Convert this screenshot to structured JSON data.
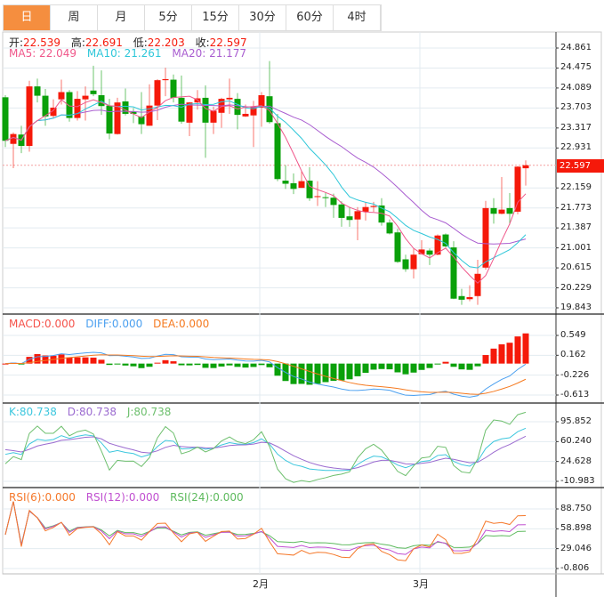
{
  "tabs": [
    "日",
    "周",
    "月",
    "5分",
    "15分",
    "30分",
    "60分",
    "4时"
  ],
  "active_tab": 0,
  "ohlc_header": {
    "open_label": "开:",
    "open": "22.539",
    "high_label": "高:",
    "high": "22.691",
    "low_label": "低:",
    "low": "22.203",
    "close_label": "收:",
    "close": "22.597"
  },
  "ma_header": {
    "ma5": "MA5: 22.049",
    "ma10": "MA10: 21.261",
    "ma20": "MA20: 21.177"
  },
  "macd_header": {
    "macd": "MACD:0.000",
    "diff": "DIFF:0.000",
    "dea": "DEA:0.000"
  },
  "kdj_header": {
    "k": "K:80.738",
    "d": "D:80.738",
    "j": "J:80.738"
  },
  "rsi_header": {
    "rsi6": "RSI(6):0.000",
    "rsi12": "RSI(12):0.000",
    "rsi24": "RSI(24):0.000"
  },
  "colors": {
    "up": "#F5190A",
    "down": "#0AA00A",
    "ma5": "#F0578A",
    "ma10": "#2EC7D9",
    "ma20": "#A95DD0",
    "diff": "#4BA0F0",
    "dea": "#F57A20",
    "k": "#3DC7DE",
    "d": "#9B6BD0",
    "j": "#6DBF6D",
    "rsi6": "#F5782A",
    "rsi12": "#C04FD0",
    "rsi24": "#5DBA5D",
    "tab_active": "#F58E3F"
  },
  "current_price": "22.597",
  "chart_data": {
    "type": "candlestick",
    "x_labels": [
      {
        "index": 32,
        "label": "2月"
      },
      {
        "index": 52,
        "label": "3月"
      }
    ],
    "price_ticks": [
      "24.861",
      "24.475",
      "24.089",
      "23.703",
      "23.317",
      "22.931",
      "22.159",
      "21.773",
      "21.387",
      "21.001",
      "20.615",
      "20.229",
      "19.843"
    ],
    "price_range": [
      19.843,
      24.861
    ],
    "macd_ticks": [
      "0.549",
      "0.162",
      "-0.226",
      "-0.613"
    ],
    "macd_range": [
      -0.613,
      0.549
    ],
    "kdj_ticks": [
      "95.852",
      "60.240",
      "24.628",
      "-10.983"
    ],
    "kdj_range": [
      -10.983,
      95.852
    ],
    "rsi_ticks": [
      "88.750",
      "58.898",
      "29.046",
      "-0.806"
    ],
    "rsi_range": [
      -0.806,
      88.75
    ],
    "candles": [
      [
        23.91,
        23.95,
        22.95,
        23.07
      ],
      [
        23.01,
        23.23,
        22.54,
        23.2
      ],
      [
        23.19,
        23.36,
        22.83,
        22.97
      ],
      [
        22.97,
        24.23,
        22.86,
        24.12
      ],
      [
        24.12,
        24.27,
        23.81,
        23.94
      ],
      [
        23.94,
        24.07,
        23.36,
        23.54
      ],
      [
        23.55,
        23.87,
        23.5,
        23.71
      ],
      [
        23.87,
        24.25,
        23.77,
        24.01
      ],
      [
        24.01,
        24.05,
        23.44,
        23.51
      ],
      [
        23.51,
        24.03,
        23.46,
        23.88
      ],
      [
        23.87,
        24.12,
        23.46,
        23.94
      ],
      [
        24.04,
        24.52,
        23.93,
        23.97
      ],
      [
        23.95,
        24.43,
        23.57,
        23.74
      ],
      [
        23.75,
        23.88,
        23.1,
        23.21
      ],
      [
        23.2,
        23.9,
        23.19,
        23.81
      ],
      [
        23.83,
        24.08,
        23.56,
        23.59
      ],
      [
        23.63,
        23.7,
        23.41,
        23.59
      ],
      [
        23.54,
        24.01,
        23.2,
        23.39
      ],
      [
        23.36,
        24.16,
        23.36,
        23.75
      ],
      [
        23.75,
        24.26,
        23.47,
        24.24
      ],
      [
        24.24,
        24.48,
        23.93,
        24.26
      ],
      [
        24.25,
        24.35,
        23.81,
        23.9
      ],
      [
        23.9,
        24.33,
        23.4,
        23.44
      ],
      [
        23.42,
        23.82,
        23.16,
        23.81
      ],
      [
        23.81,
        24.05,
        23.67,
        23.89
      ],
      [
        23.9,
        24.14,
        22.74,
        23.42
      ],
      [
        23.42,
        23.73,
        23.2,
        23.65
      ],
      [
        23.61,
        23.9,
        23.32,
        23.88
      ],
      [
        23.87,
        24.27,
        23.59,
        23.9
      ],
      [
        23.88,
        23.99,
        23.29,
        23.57
      ],
      [
        23.54,
        23.77,
        23.53,
        23.59
      ],
      [
        23.56,
        23.84,
        22.95,
        23.73
      ],
      [
        23.71,
        24.01,
        23.34,
        23.95
      ],
      [
        23.93,
        24.61,
        23.4,
        23.43
      ],
      [
        23.41,
        23.59,
        22.29,
        22.33
      ],
      [
        22.3,
        22.6,
        22.14,
        22.24
      ],
      [
        22.25,
        22.44,
        22.04,
        22.14
      ],
      [
        22.16,
        22.48,
        22.16,
        22.29
      ],
      [
        22.3,
        22.56,
        21.91,
        21.96
      ],
      [
        21.99,
        22.29,
        21.81,
        22.0
      ],
      [
        21.98,
        22.07,
        21.79,
        21.97
      ],
      [
        21.97,
        22.05,
        21.58,
        21.83
      ],
      [
        21.84,
        21.9,
        21.41,
        21.58
      ],
      [
        21.61,
        21.79,
        21.41,
        21.54
      ],
      [
        21.55,
        21.79,
        21.15,
        21.71
      ],
      [
        21.7,
        21.89,
        21.53,
        21.79
      ],
      [
        21.79,
        21.89,
        21.7,
        21.81
      ],
      [
        21.82,
        21.96,
        21.43,
        21.49
      ],
      [
        21.49,
        21.55,
        21.26,
        21.28
      ],
      [
        21.3,
        21.37,
        20.71,
        20.73
      ],
      [
        20.78,
        20.87,
        20.54,
        20.59
      ],
      [
        20.59,
        20.99,
        20.41,
        20.87
      ],
      [
        20.88,
        21.15,
        20.87,
        20.97
      ],
      [
        20.95,
        20.99,
        20.67,
        20.87
      ],
      [
        20.87,
        21.26,
        20.86,
        21.24
      ],
      [
        21.26,
        21.28,
        21.01,
        21.03
      ],
      [
        21.01,
        21.13,
        20.01,
        20.02
      ],
      [
        20.07,
        20.21,
        19.9,
        20.0
      ],
      [
        20.01,
        20.28,
        19.97,
        20.05
      ],
      [
        20.07,
        20.77,
        19.9,
        20.5
      ],
      [
        20.62,
        21.91,
        20.58,
        21.77
      ],
      [
        21.77,
        21.96,
        21.47,
        21.66
      ],
      [
        21.66,
        22.37,
        21.65,
        21.74
      ],
      [
        21.77,
        22.06,
        21.45,
        21.66
      ],
      [
        21.7,
        22.58,
        21.65,
        22.57
      ],
      [
        22.539,
        22.691,
        22.203,
        22.597
      ]
    ]
  }
}
